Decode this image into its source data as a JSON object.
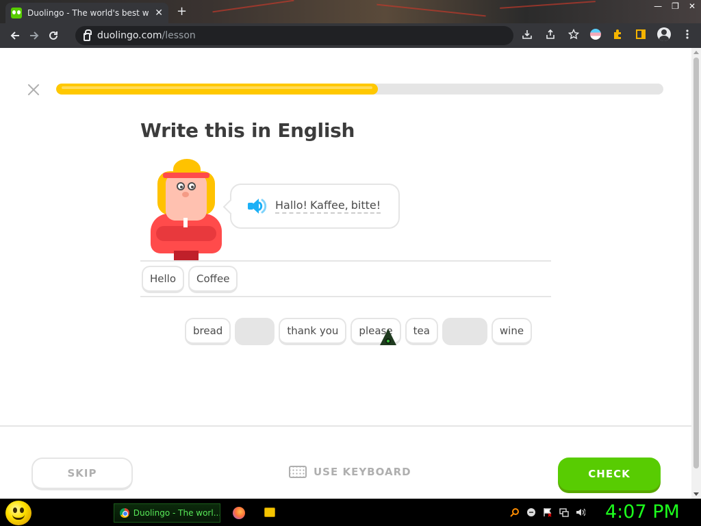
{
  "browser": {
    "tab_title": "Duolingo - The world's best way",
    "tab_close": "✕",
    "new_tab": "+",
    "url_host": "duolingo.com",
    "url_path": "/lesson",
    "window_controls": [
      "—",
      "❐",
      "✕"
    ]
  },
  "lesson": {
    "progress": 0.53,
    "heading": "Write this in English",
    "prompt_words": [
      "Hallo!",
      "Kaffee,",
      "bitte!"
    ],
    "answer_chips": [
      "Hello",
      "Coffee"
    ],
    "word_bank": [
      {
        "label": "bread",
        "used": false
      },
      {
        "label": "",
        "used": true
      },
      {
        "label": "thank you",
        "used": false
      },
      {
        "label": "please",
        "used": false
      },
      {
        "label": "tea",
        "used": false
      },
      {
        "label": "",
        "used": true
      },
      {
        "label": "wine",
        "used": false
      }
    ],
    "skip_label": "SKIP",
    "keyboard_label": "USE KEYBOARD",
    "check_label": "CHECK"
  },
  "taskbar": {
    "task_label": "Duolingo - The worl...",
    "clock": "4:07 PM"
  },
  "colors": {
    "progress": "#ffc800",
    "check_button": "#58cc02",
    "speaker": "#1cb0f6",
    "clock": "#1dff1d"
  }
}
